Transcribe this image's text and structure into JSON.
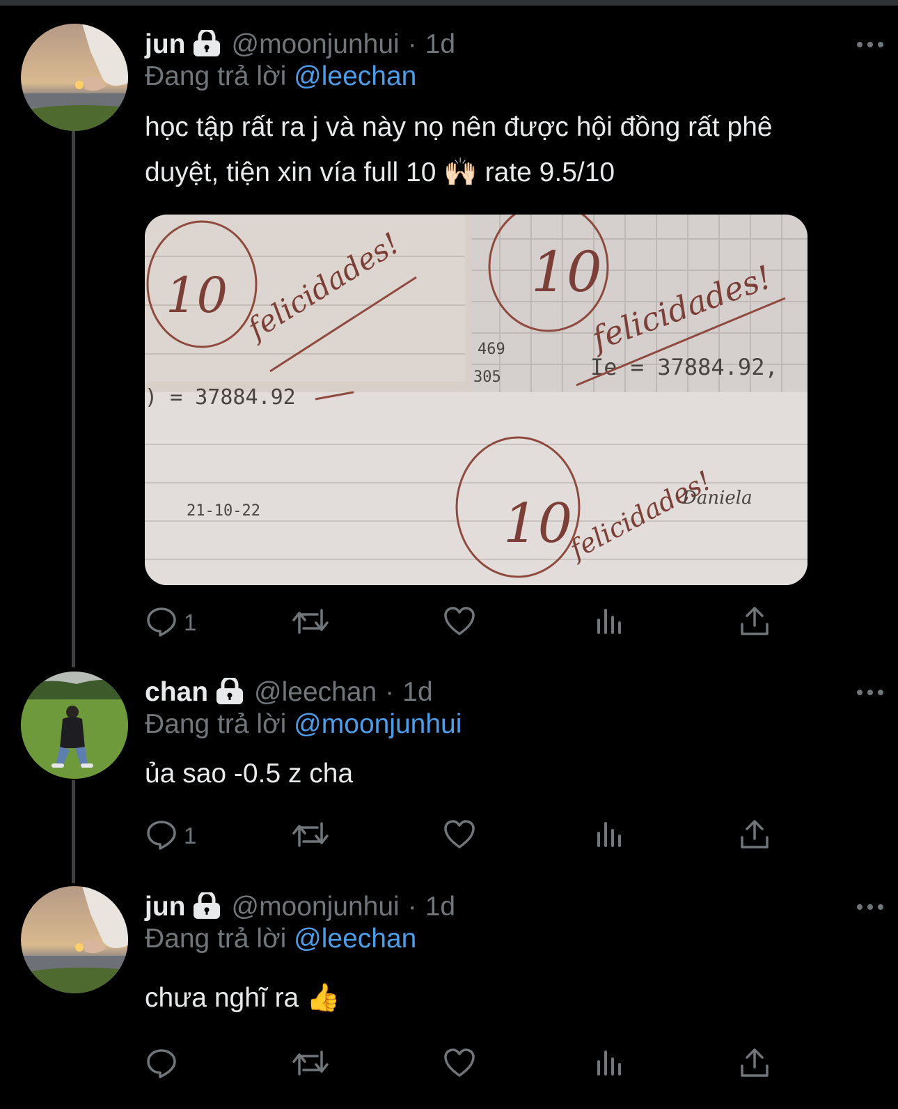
{
  "tweets": [
    {
      "name": "jun",
      "handle": "@moonjunhui",
      "time": "1d",
      "reply_prefix": "Đang trả lời",
      "reply_to": "@leechan",
      "text_line1": "học tập rất ra j và này nọ nên được hội đồng rất phê",
      "text_line2": "duyệt, tiện xin vía full 10 🙌🏻 rate 9.5/10",
      "reply_count": "1",
      "lock_icon": "lock-icon",
      "has_media": true,
      "media": {
        "handwriting": {
          "score": "10",
          "congrats": "felicidades!",
          "calc_left": ") = 37884.92",
          "calc_right": "Ie = 37884.92,",
          "fraction_top": "469",
          "fraction_bottom": "305",
          "date": "21-10-22",
          "signature": "Daniela"
        }
      }
    },
    {
      "name": "chan",
      "handle": "@leechan",
      "time": "1d",
      "reply_prefix": "Đang trả lời",
      "reply_to": "@moonjunhui",
      "text_line1": "ủa sao -0.5 z cha",
      "reply_count": "1"
    },
    {
      "name": "jun",
      "handle": "@moonjunhui",
      "time": "1d",
      "reply_prefix": "Đang trả lời",
      "reply_to": "@leechan",
      "text_line1": "chưa nghĩ ra 👍",
      "reply_count": ""
    }
  ],
  "separator": "·",
  "colors": {
    "background": "#000000",
    "text": "#e7e9ea",
    "muted": "#71767b",
    "link": "#4d9eea",
    "thread_line": "#3e4144"
  },
  "icons": [
    "reply-icon",
    "retweet-icon",
    "like-icon",
    "analytics-icon",
    "share-icon",
    "more-icon",
    "lock-icon"
  ]
}
